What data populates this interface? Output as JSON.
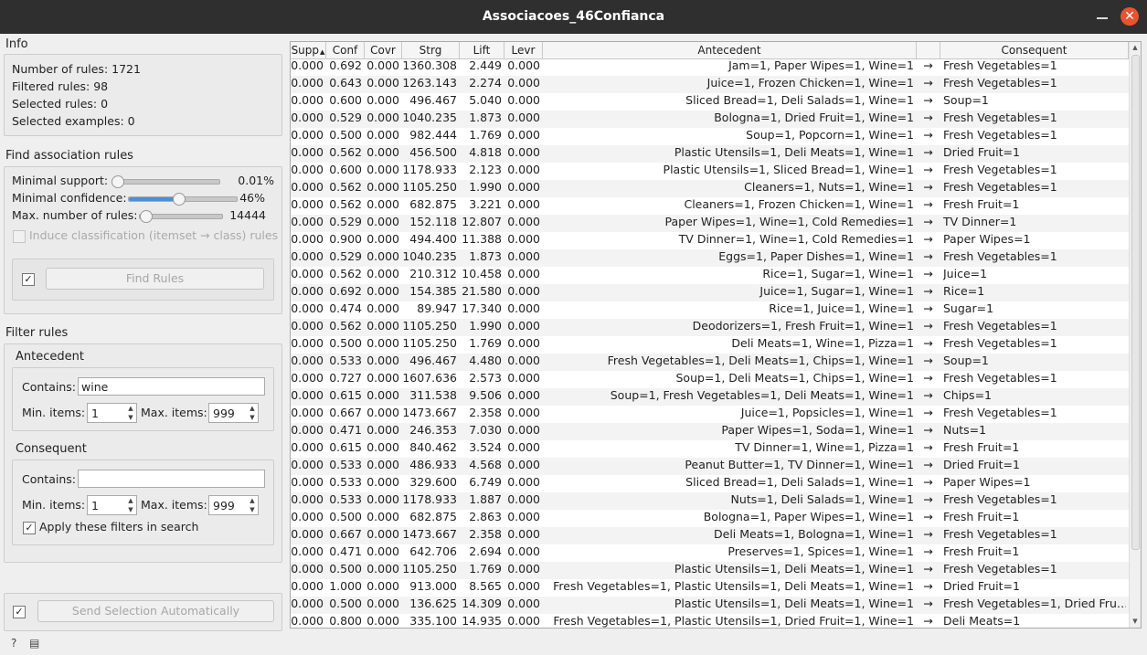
{
  "window": {
    "title": "Associacoes_46Confianca"
  },
  "info": {
    "title": "Info",
    "lines": [
      "Number of rules: 1721",
      "Filtered rules: 98",
      "Selected rules: 0",
      "Selected examples: 0"
    ]
  },
  "find": {
    "title": "Find association rules",
    "min_support": {
      "label": "Minimal support:",
      "value": "0.01%",
      "level": 0.05
    },
    "min_confidence": {
      "label": "Minimal confidence:",
      "value": "46%",
      "level": 0.46
    },
    "max_rules": {
      "label": "Max. number of rules:",
      "value": "14444",
      "level": 0.05
    },
    "induce_label": "Induce classification (itemset → class) rules",
    "find_button": "Find Rules",
    "find_auto_checked": "✓"
  },
  "filter": {
    "title": "Filter rules",
    "antecedent": {
      "title": "Antecedent",
      "contains_label": "Contains:",
      "contains_value": "wine",
      "min_label": "Min. items:",
      "min_value": "1",
      "max_label": "Max. items:",
      "max_value": "999"
    },
    "consequent": {
      "title": "Consequent",
      "contains_label": "Contains:",
      "contains_value": "",
      "min_label": "Min. items:",
      "min_value": "1",
      "max_label": "Max. items:",
      "max_value": "999"
    },
    "apply_label": "Apply these filters in search",
    "apply_checked": "✓"
  },
  "send": {
    "label": "Send Selection Automatically",
    "checked": "✓"
  },
  "status": {
    "help_icon": "?",
    "report_icon": "▤"
  },
  "table": {
    "headers": [
      "Supp",
      "Conf",
      "Covr",
      "Strg",
      "Lift",
      "Levr",
      "Antecedent",
      "",
      "Consequent"
    ],
    "sort_icon": "▲",
    "rows": [
      [
        "0.000",
        "0.692",
        "0.000",
        "1360.308",
        "2.449",
        "0.000",
        "Jam=1, Paper Wipes=1, Wine=1",
        "→",
        "Fresh Vegetables=1"
      ],
      [
        "0.000",
        "0.643",
        "0.000",
        "1263.143",
        "2.274",
        "0.000",
        "Juice=1, Frozen Chicken=1, Wine=1",
        "→",
        "Fresh Vegetables=1"
      ],
      [
        "0.000",
        "0.600",
        "0.000",
        "496.467",
        "5.040",
        "0.000",
        "Sliced Bread=1, Deli Salads=1, Wine=1",
        "→",
        "Soup=1"
      ],
      [
        "0.000",
        "0.529",
        "0.000",
        "1040.235",
        "1.873",
        "0.000",
        "Bologna=1, Dried Fruit=1, Wine=1",
        "→",
        "Fresh Vegetables=1"
      ],
      [
        "0.000",
        "0.500",
        "0.000",
        "982.444",
        "1.769",
        "0.000",
        "Soup=1, Popcorn=1, Wine=1",
        "→",
        "Fresh Vegetables=1"
      ],
      [
        "0.000",
        "0.562",
        "0.000",
        "456.500",
        "4.818",
        "0.000",
        "Plastic Utensils=1, Deli Meats=1, Wine=1",
        "→",
        "Dried Fruit=1"
      ],
      [
        "0.000",
        "0.600",
        "0.000",
        "1178.933",
        "2.123",
        "0.000",
        "Plastic Utensils=1, Sliced Bread=1, Wine=1",
        "→",
        "Fresh Vegetables=1"
      ],
      [
        "0.000",
        "0.562",
        "0.000",
        "1105.250",
        "1.990",
        "0.000",
        "Cleaners=1, Nuts=1, Wine=1",
        "→",
        "Fresh Vegetables=1"
      ],
      [
        "0.000",
        "0.562",
        "0.000",
        "682.875",
        "3.221",
        "0.000",
        "Cleaners=1, Frozen Chicken=1, Wine=1",
        "→",
        "Fresh Fruit=1"
      ],
      [
        "0.000",
        "0.529",
        "0.000",
        "152.118",
        "12.807",
        "0.000",
        "Paper Wipes=1, Wine=1, Cold Remedies=1",
        "→",
        "TV Dinner=1"
      ],
      [
        "0.000",
        "0.900",
        "0.000",
        "494.400",
        "11.388",
        "0.000",
        "TV Dinner=1, Wine=1, Cold Remedies=1",
        "→",
        "Paper Wipes=1"
      ],
      [
        "0.000",
        "0.529",
        "0.000",
        "1040.235",
        "1.873",
        "0.000",
        "Eggs=1, Paper Dishes=1, Wine=1",
        "→",
        "Fresh Vegetables=1"
      ],
      [
        "0.000",
        "0.562",
        "0.000",
        "210.312",
        "10.458",
        "0.000",
        "Rice=1, Sugar=1, Wine=1",
        "→",
        "Juice=1"
      ],
      [
        "0.000",
        "0.692",
        "0.000",
        "154.385",
        "21.580",
        "0.000",
        "Juice=1, Sugar=1, Wine=1",
        "→",
        "Rice=1"
      ],
      [
        "0.000",
        "0.474",
        "0.000",
        "89.947",
        "17.340",
        "0.000",
        "Rice=1, Juice=1, Wine=1",
        "→",
        "Sugar=1"
      ],
      [
        "0.000",
        "0.562",
        "0.000",
        "1105.250",
        "1.990",
        "0.000",
        "Deodorizers=1, Fresh Fruit=1, Wine=1",
        "→",
        "Fresh Vegetables=1"
      ],
      [
        "0.000",
        "0.500",
        "0.000",
        "1105.250",
        "1.769",
        "0.000",
        "Deli Meats=1, Wine=1, Pizza=1",
        "→",
        "Fresh Vegetables=1"
      ],
      [
        "0.000",
        "0.533",
        "0.000",
        "496.467",
        "4.480",
        "0.000",
        "Fresh Vegetables=1, Deli Meats=1, Chips=1, Wine=1",
        "→",
        "Soup=1"
      ],
      [
        "0.000",
        "0.727",
        "0.000",
        "1607.636",
        "2.573",
        "0.000",
        "Soup=1, Deli Meats=1, Chips=1, Wine=1",
        "→",
        "Fresh Vegetables=1"
      ],
      [
        "0.000",
        "0.615",
        "0.000",
        "311.538",
        "9.506",
        "0.000",
        "Soup=1, Fresh Vegetables=1, Deli Meats=1, Wine=1",
        "→",
        "Chips=1"
      ],
      [
        "0.000",
        "0.667",
        "0.000",
        "1473.667",
        "2.358",
        "0.000",
        "Juice=1, Popsicles=1, Wine=1",
        "→",
        "Fresh Vegetables=1"
      ],
      [
        "0.000",
        "0.471",
        "0.000",
        "246.353",
        "7.030",
        "0.000",
        "Paper Wipes=1, Soda=1, Wine=1",
        "→",
        "Nuts=1"
      ],
      [
        "0.000",
        "0.615",
        "0.000",
        "840.462",
        "3.524",
        "0.000",
        "TV Dinner=1, Wine=1, Pizza=1",
        "→",
        "Fresh Fruit=1"
      ],
      [
        "0.000",
        "0.533",
        "0.000",
        "486.933",
        "4.568",
        "0.000",
        "Peanut Butter=1, TV Dinner=1, Wine=1",
        "→",
        "Dried Fruit=1"
      ],
      [
        "0.000",
        "0.533",
        "0.000",
        "329.600",
        "6.749",
        "0.000",
        "Sliced Bread=1, Deli Salads=1, Wine=1",
        "→",
        "Paper Wipes=1"
      ],
      [
        "0.000",
        "0.533",
        "0.000",
        "1178.933",
        "1.887",
        "0.000",
        "Nuts=1, Deli Salads=1, Wine=1",
        "→",
        "Fresh Vegetables=1"
      ],
      [
        "0.000",
        "0.500",
        "0.000",
        "682.875",
        "2.863",
        "0.000",
        "Bologna=1, Paper Wipes=1, Wine=1",
        "→",
        "Fresh Fruit=1"
      ],
      [
        "0.000",
        "0.667",
        "0.000",
        "1473.667",
        "2.358",
        "0.000",
        "Deli Meats=1, Bologna=1, Wine=1",
        "→",
        "Fresh Vegetables=1"
      ],
      [
        "0.000",
        "0.471",
        "0.000",
        "642.706",
        "2.694",
        "0.000",
        "Preserves=1, Spices=1, Wine=1",
        "→",
        "Fresh Fruit=1"
      ],
      [
        "0.000",
        "0.500",
        "0.000",
        "1105.250",
        "1.769",
        "0.000",
        "Plastic Utensils=1, Deli Meats=1, Wine=1",
        "→",
        "Fresh Vegetables=1"
      ],
      [
        "0.000",
        "1.000",
        "0.000",
        "913.000",
        "8.565",
        "0.000",
        "Fresh Vegetables=1, Plastic Utensils=1, Deli Meats=1, Wine=1",
        "→",
        "Dried Fruit=1"
      ],
      [
        "0.000",
        "0.500",
        "0.000",
        "136.625",
        "14.309",
        "0.000",
        "Plastic Utensils=1, Deli Meats=1, Wine=1",
        "→",
        "Fresh Vegetables=1, Dried Fru…"
      ],
      [
        "0.000",
        "0.800",
        "0.000",
        "335.100",
        "14.935",
        "0.000",
        "Fresh Vegetables=1, Plastic Utensils=1, Dried Fruit=1, Wine=1",
        "→",
        "Deli Meats=1"
      ]
    ]
  }
}
